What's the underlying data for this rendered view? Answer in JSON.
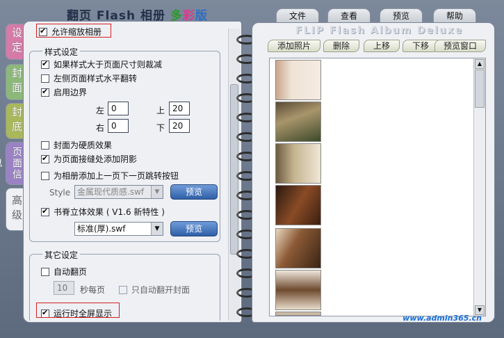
{
  "title": {
    "part1": "翻页 Flash 相册 ",
    "part2": "多",
    "part3": "彩",
    "part4": "版"
  },
  "menu": [
    "文件",
    "查看",
    "预览",
    "帮助"
  ],
  "side_tabs": [
    "设定",
    "封面",
    "封底",
    "页面信息",
    "高级"
  ],
  "top_option": {
    "label": "允许缩放相册",
    "checked": true
  },
  "style_group": {
    "title": "样式设定",
    "opt1": "如果样式大于页面尺寸则裁减",
    "opt2": "左侧页面样式水平翻转",
    "opt3": "启用边界",
    "left_label": "左",
    "left_value": "0",
    "top_label": "上",
    "top_value": "20",
    "right_label": "右",
    "right_value": "0",
    "bottom_label": "下",
    "bottom_value": "20",
    "opt4": "封面为硬质效果",
    "opt5": "为页面接缝处添加阴影",
    "opt6": "为相册添加上一页下一页跳转按钮",
    "style_label": "Style",
    "style_value": "金属现代质感.swf",
    "preview1": "预览",
    "opt7": "书脊立体效果 ( V1.6 新特性 )",
    "spine_value": "标准(厚).swf",
    "preview2": "预览"
  },
  "other_group": {
    "title": "其它设定",
    "auto_flip": "自动翻页",
    "seconds_value": "10",
    "seconds_label": "秒每页",
    "cover_only": "只自动翻开封面",
    "fullscreen": "运行时全屏显示"
  },
  "right": {
    "flip_title": "FLIP Flash Album Deluxe",
    "toolbar": [
      "添加照片",
      "删除",
      "上移",
      "下移",
      "预览窗口"
    ]
  },
  "watermark": "www.admin365.cn"
}
